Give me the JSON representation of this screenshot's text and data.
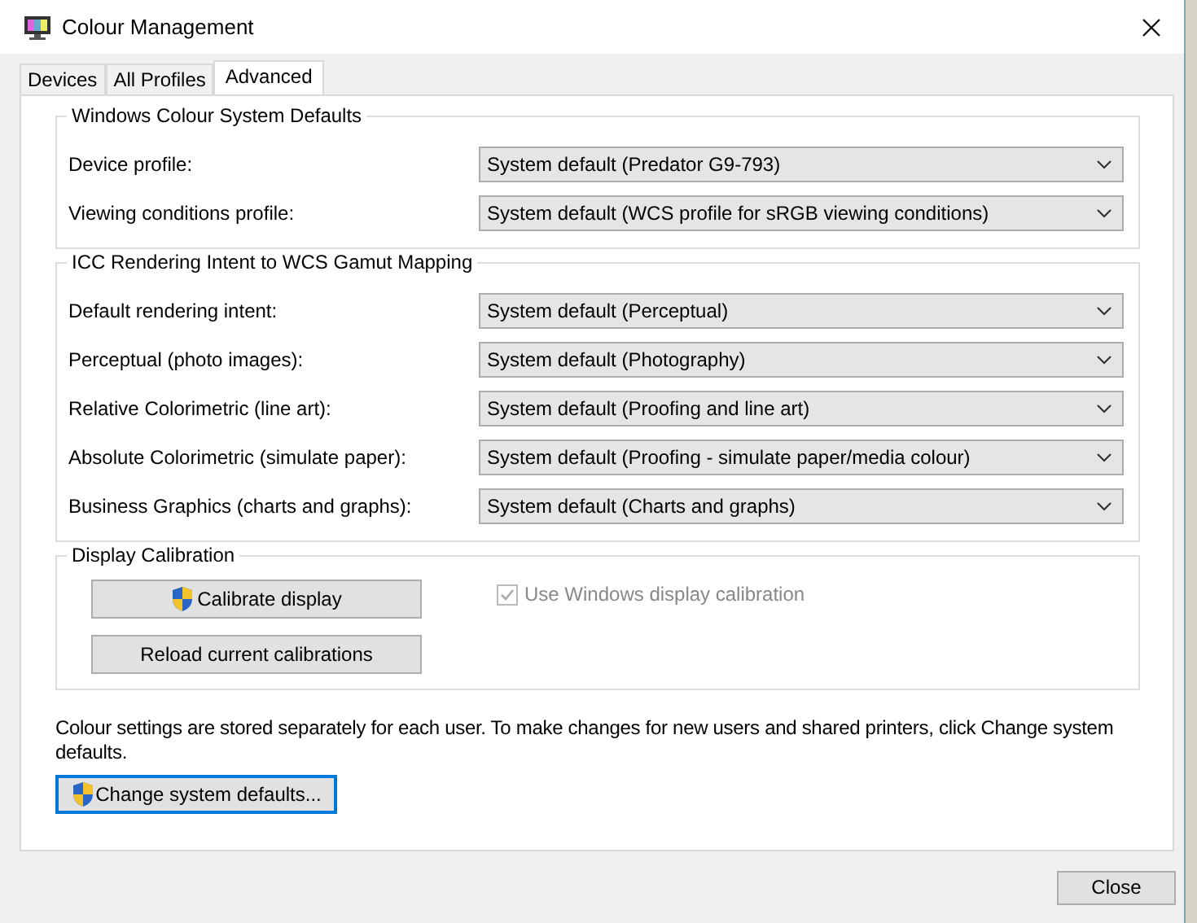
{
  "window": {
    "title": "Colour Management"
  },
  "tabs": [
    {
      "label": "Devices",
      "selected": false
    },
    {
      "label": "All Profiles",
      "selected": false
    },
    {
      "label": "Advanced",
      "selected": true
    }
  ],
  "sections": [
    {
      "title": "Windows Colour System Defaults",
      "rows": [
        {
          "label": "Device profile:",
          "value": "System default (Predator G9-793)"
        },
        {
          "label": "Viewing conditions profile:",
          "value": "System default (WCS profile for sRGB viewing conditions)"
        }
      ]
    },
    {
      "title": "ICC Rendering Intent to WCS Gamut Mapping",
      "rows": [
        {
          "label": "Default rendering intent:",
          "value": "System default (Perceptual)"
        },
        {
          "label": "Perceptual (photo images):",
          "value": "System default (Photography)"
        },
        {
          "label": "Relative Colorimetric (line art):",
          "value": "System default (Proofing and line art)"
        },
        {
          "label": "Absolute Colorimetric (simulate paper):",
          "value": "System default (Proofing - simulate paper/media colour)"
        },
        {
          "label": "Business Graphics (charts and graphs):",
          "value": "System default (Charts and graphs)"
        }
      ]
    }
  ],
  "calibration": {
    "title": "Display Calibration",
    "buttons": [
      {
        "label": "Calibrate display",
        "shield": true
      },
      {
        "label": "Reload current calibrations",
        "shield": false
      }
    ],
    "checkbox": {
      "label": "Use Windows display calibration",
      "checked": true,
      "disabled": true
    }
  },
  "note": "Colour settings are stored separately for each user. To make changes for new users and shared printers, click Change system defaults.",
  "change_button": {
    "label": "Change system defaults...",
    "focused": true
  },
  "close_button": "Close"
}
